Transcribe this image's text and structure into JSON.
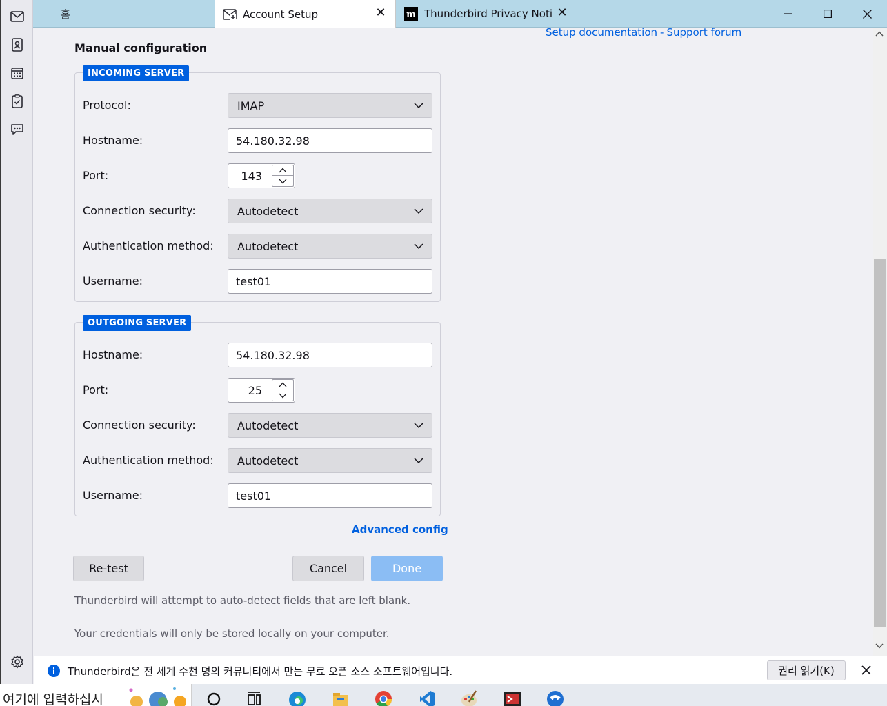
{
  "tabs": [
    {
      "label": "홈"
    },
    {
      "label": "Account Setup"
    },
    {
      "label": "Thunderbird Privacy Notice"
    }
  ],
  "window": {
    "minimize": "—",
    "maximize": "☐",
    "close": "✕"
  },
  "links": {
    "setup_docs": "Setup documentation",
    "separator": "-",
    "support": "Support forum"
  },
  "heading": "Manual configuration",
  "incoming": {
    "legend": "INCOMING SERVER",
    "protocol_label": "Protocol:",
    "protocol": "IMAP",
    "hostname_label": "Hostname:",
    "hostname": "54.180.32.98",
    "port_label": "Port:",
    "port": "143",
    "security_label": "Connection security:",
    "security": "Autodetect",
    "auth_label": "Authentication method:",
    "auth": "Autodetect",
    "username_label": "Username:",
    "username": "test01"
  },
  "outgoing": {
    "legend": "OUTGOING SERVER",
    "hostname_label": "Hostname:",
    "hostname": "54.180.32.98",
    "port_label": "Port:",
    "port": "25",
    "security_label": "Connection security:",
    "security": "Autodetect",
    "auth_label": "Authentication method:",
    "auth": "Autodetect",
    "username_label": "Username:",
    "username": "test01"
  },
  "advanced": "Advanced config",
  "buttons": {
    "retest": "Re-test",
    "cancel": "Cancel",
    "done": "Done"
  },
  "notes": [
    "Thunderbird will attempt to auto-detect fields that are left blank.",
    "Your credentials will only be stored locally on your computer."
  ],
  "notification": {
    "message": "Thunderbird은 전 세계 수천 명의 커뮤니티에서 만든 무료 오픈 소스 소프트웨어입니다.",
    "button": "권리 읽기(K)"
  },
  "taskbar": {
    "search_placeholder": "여기에 입력하십시"
  },
  "colors": {
    "accent": "#0060df",
    "tabbar": "#b5d8e8",
    "done_disabled": "#8bbdf4"
  }
}
